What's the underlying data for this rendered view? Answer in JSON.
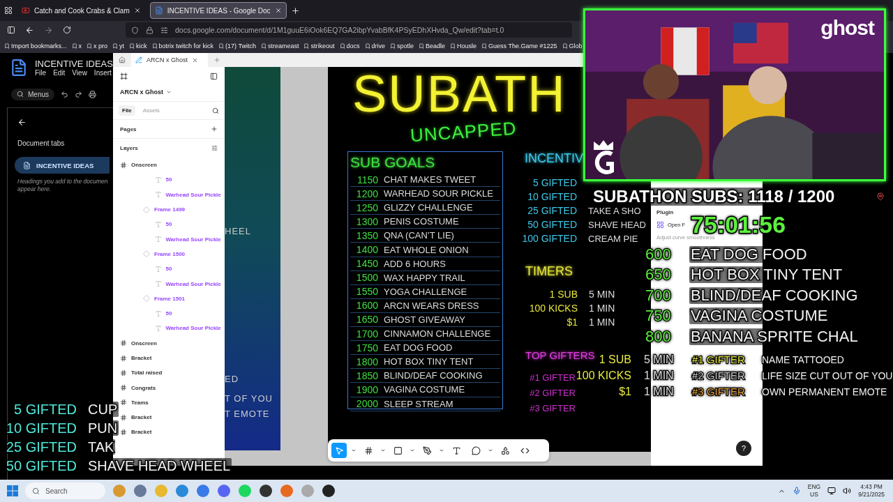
{
  "browser": {
    "tabs": [
      {
        "title": "Catch and Cook Crabs & Clam",
        "kind": "video",
        "selected": false
      },
      {
        "title": "INCENTIVE IDEAS - Google Doc",
        "kind": "doc",
        "selected": true
      }
    ],
    "url": {
      "host": "docs.google.com",
      "path": "/document/d/1M1guuE6iOok6EQ7GA2ibpYvabBfK4PSyEDhXHvda_Qw/edit?tab=t.0"
    },
    "bookmarks": [
      "Import bookmarks...",
      "x",
      "x pro",
      "yt",
      "kick",
      "botrix twitch for kick",
      "(17) Twitch",
      "streameast",
      "strikeout",
      "docs",
      "drive",
      "spotle",
      "Beadle",
      "Housle",
      "Guess The.Game #1225",
      "Glob"
    ]
  },
  "docs": {
    "title": "INCENTIVE IDEAS",
    "menu": [
      "File",
      "Edit",
      "View",
      "Insert"
    ],
    "search_placeholder": "Menus",
    "sidebar_title": "Document tabs",
    "tabs": [
      {
        "label": "INCENTIVE IDEAS",
        "selected": true
      }
    ],
    "hint": "Headings you add to the documen appear here."
  },
  "figma": {
    "tab_title": "ARCN x Ghost",
    "file_name": "ARCN x Ghost",
    "panel_tabs": [
      {
        "label": "File",
        "selected": true
      },
      {
        "label": "Assets",
        "selected": false
      }
    ],
    "pages_label": "Pages",
    "layers_label": "Layers",
    "layers": [
      {
        "name": "Onscreen",
        "kind": "frame",
        "children": [
          {
            "children": [
              {
                "children": [
                  {
                    "name": "50",
                    "kind": "text"
                  },
                  {
                    "name": "Warhead Sour Pickle",
                    "kind": "text"
                  }
                ]
              },
              {
                "name": "Frame 1499",
                "kind": "component",
                "children": [
                  {
                    "name": "50",
                    "kind": "text"
                  },
                  {
                    "name": "Warhead Sour Pickle",
                    "kind": "text"
                  }
                ]
              },
              {
                "name": "Frame 1500",
                "kind": "component",
                "children": [
                  {
                    "name": "50",
                    "kind": "text"
                  },
                  {
                    "name": "Warhead Sour Pickle",
                    "kind": "text"
                  }
                ]
              },
              {
                "name": "Frame 1501",
                "kind": "component",
                "children": [
                  {
                    "name": "50",
                    "kind": "text"
                  },
                  {
                    "name": "Warhead Sour Pickle",
                    "kind": "text"
                  }
                ]
              }
            ]
          }
        ]
      },
      {
        "name": "Onscreen",
        "kind": "frame"
      },
      {
        "name": "Bracket",
        "kind": "frame"
      },
      {
        "name": "Total raised",
        "kind": "frame"
      },
      {
        "name": "Congrats",
        "kind": "frame"
      },
      {
        "name": "Teams",
        "kind": "frame"
      },
      {
        "name": "Bracket",
        "kind": "frame"
      },
      {
        "name": "Bracket",
        "kind": "frame"
      }
    ],
    "side_frame_texts": [
      "HEEL",
      "ED",
      "T OF YOU",
      "T EMOTE"
    ],
    "design": {
      "title": "SUBATH",
      "subtitle": "UNCAPPED",
      "goals_heading": "SUB GOALS",
      "goals": [
        {
          "subs": "1150",
          "reward": "CHAT MAKES TWEET"
        },
        {
          "subs": "1200",
          "reward": "WARHEAD SOUR PICKLE"
        },
        {
          "subs": "1250",
          "reward": "GLIZZY CHALLENGE"
        },
        {
          "subs": "1300",
          "reward": "PENIS COSTUME"
        },
        {
          "subs": "1350",
          "reward": "QNA (CAN’T LIE)"
        },
        {
          "subs": "1400",
          "reward": "EAT WHOLE ONION"
        },
        {
          "subs": "1450",
          "reward": "ADD 6 HOURS"
        },
        {
          "subs": "1500",
          "reward": "WAX HAPPY TRAIL"
        },
        {
          "subs": "1550",
          "reward": "YOGA CHALLENGE"
        },
        {
          "subs": "1600",
          "reward": "ARCN WEARS DRESS"
        },
        {
          "subs": "1650",
          "reward": "GHOST GIVEAWAY"
        },
        {
          "subs": "1700",
          "reward": "CINNAMON CHALLENGE"
        },
        {
          "subs": "1750",
          "reward": "EAT DOG FOOD"
        },
        {
          "subs": "1800",
          "reward": "HOT BOX TINY TENT"
        },
        {
          "subs": "1850",
          "reward": "BLIND/DEAF COOKING"
        },
        {
          "subs": "1900",
          "reward": "VAGINA COSTUME"
        },
        {
          "subs": "2000",
          "reward": "SLEEP STREAM"
        }
      ],
      "incentives_heading": "INCENTIV",
      "incentives": [
        {
          "count": "5 GIFTED"
        },
        {
          "count": "10 GIFTED"
        },
        {
          "count": "25 GIFTED",
          "reward": "TAKE A SHO"
        },
        {
          "count": "50 GIFTED",
          "reward": "SHAVE HEAD"
        },
        {
          "count": "100 GIFTED",
          "reward": "CREAM PIE"
        }
      ],
      "timers_heading": "TIMERS",
      "timers": [
        {
          "amount": "1 SUB",
          "time": "5 MIN"
        },
        {
          "amount": "100 KICKS",
          "time": "1 MIN"
        },
        {
          "amount": "$1",
          "time": "1 MIN"
        }
      ],
      "gifters_heading": "TOP GIFTERS",
      "gifters": [
        {
          "rank": "#1 GIFTER"
        },
        {
          "rank": "#2 GIFTER"
        },
        {
          "rank": "#3 GIFTER"
        }
      ]
    },
    "plugin": {
      "section": "Plugin",
      "name": "Open F",
      "hint": "Adjust curve smoothness"
    },
    "help": "?"
  },
  "stream_overlay": {
    "logo": "ghost",
    "subs": "SUBATHON SUBS: 1118 / 1200",
    "timer": "75:01:56",
    "goals": [
      {
        "subs": "600",
        "reward": "EAT DOG FOOD"
      },
      {
        "subs": "650",
        "reward": "HOT BOX TINY TENT"
      },
      {
        "subs": "700",
        "reward": "BLIND/DEAF COOKING"
      },
      {
        "subs": "750",
        "reward": "VAGINA COSTUME"
      },
      {
        "subs": "800",
        "reward": "BANANA SPRITE CHAL"
      }
    ],
    "timers": [
      {
        "amount": "1 SUB",
        "time": "5 MIN"
      },
      {
        "amount": "100 KICKS",
        "time": "1 MIN"
      },
      {
        "amount": "$1",
        "time": "1 MIN"
      }
    ],
    "gifters": [
      {
        "rank": "#1 GIFTER",
        "reward": "NAME TATTOOED",
        "color": "#e6ea3c"
      },
      {
        "rank": "#2 GIFTER",
        "reward": "LIFE SIZE CUT OUT OF YOU",
        "color": "#c8c8c8"
      },
      {
        "rank": "#3 GIFTER",
        "reward": "OWN PERMANENT EMOTE",
        "color": "#e8a33a"
      }
    ],
    "incentives": [
      {
        "count": "5 GIFTED",
        "reward": "CUP"
      },
      {
        "count": "10 GIFTED",
        "reward": "PUN"
      },
      {
        "count": "25 GIFTED",
        "reward": "TAK"
      },
      {
        "count": "50 GIFTED",
        "reward": "SHAVE HEAD WHEEL"
      }
    ]
  },
  "taskbar": {
    "search_placeholder": "Search",
    "language": "ENG",
    "region": "US",
    "time": "4:43 PM",
    "date": "9/21/2025"
  }
}
